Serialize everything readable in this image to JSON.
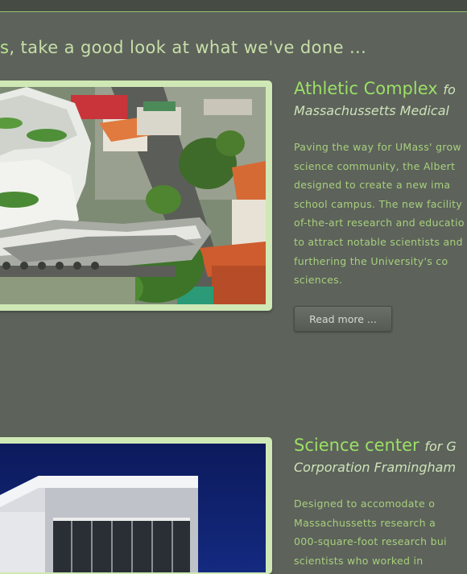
{
  "tagline": {
    "lead": "s",
    "rest": ", take a good look at what we've done ..."
  },
  "projects": [
    {
      "title": "Athletic Complex",
      "for": "fo",
      "client": "Massachussetts Medical",
      "description_lines": [
        "Paving the way for UMass' grow",
        "science community, the Albert",
        "designed to create a new ima",
        "school campus. The new facility",
        "of-the-art research and educatio",
        "to attract notable scientists and",
        "furthering the University's co",
        "sciences."
      ],
      "read_more": "Read more ..."
    },
    {
      "title": "Science center",
      "for": "for G",
      "client": "Corporation Framingham",
      "description_lines": [
        "Designed to accomodate o",
        "Massachussetts research a",
        "000-square-foot research bui",
        "scientists who worked in"
      ]
    }
  ]
}
